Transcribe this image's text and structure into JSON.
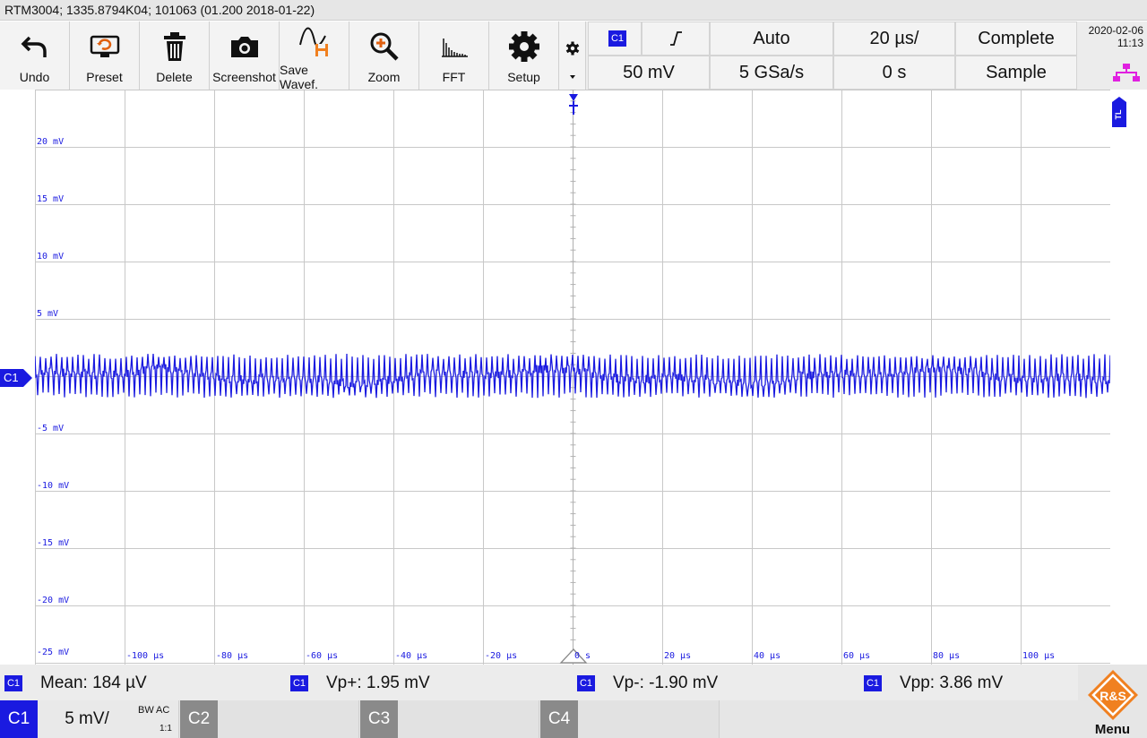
{
  "title": "RTM3004; 1335.8794K04; 101063 (01.200 2018-01-22)",
  "toolbar": [
    {
      "label": "Undo",
      "icon": "undo-icon"
    },
    {
      "label": "Preset",
      "icon": "preset-icon"
    },
    {
      "label": "Delete",
      "icon": "trash-icon"
    },
    {
      "label": "Screenshot",
      "icon": "camera-icon"
    },
    {
      "label": "Save Wavef.",
      "icon": "save-waveform-icon"
    },
    {
      "label": "Zoom",
      "icon": "zoom-icon"
    },
    {
      "label": "FFT",
      "icon": "fft-icon"
    },
    {
      "label": "Setup",
      "icon": "gear-icon"
    }
  ],
  "settings": {
    "trigger_source": "C1",
    "trigger_slope_icon": "rising-edge-icon",
    "trigger_mode": "Auto",
    "timebase": "20 µs/",
    "acquisition_state": "Complete",
    "trigger_level": "50 mV",
    "sample_rate": "5 GSa/s",
    "trigger_offset": "0 s",
    "acquisition_mode": "Sample"
  },
  "datetime": {
    "date": "2020-02-06",
    "time": "11:13"
  },
  "plot": {
    "y_labels": [
      "20 mV",
      "15 mV",
      "10 mV",
      "5 mV",
      "-5 mV",
      "-10 mV",
      "-15 mV",
      "-20 mV",
      "-25 mV"
    ],
    "x_labels": [
      "-100 µs",
      "-80 µs",
      "-60 µs",
      "-40 µs",
      "-20 µs",
      "0 s",
      "20 µs",
      "40 µs",
      "60 µs",
      "80 µs",
      "100 µs"
    ],
    "channel_marker": "C1",
    "trigger_level_marker": "TL",
    "trace_color": "#1a1ae0"
  },
  "measurements": [
    {
      "channel": "C1",
      "text": "Mean: 184 µV"
    },
    {
      "channel": "C1",
      "text": "Vp+: 1.95 mV"
    },
    {
      "channel": "C1",
      "text": "Vp-: -1.90 mV"
    },
    {
      "channel": "C1",
      "text": "Vpp: 3.86 mV"
    }
  ],
  "channels": {
    "c1": {
      "label": "C1",
      "scale": "5 mV/",
      "bw": "BW",
      "coupling": "AC",
      "probe": "1:1"
    },
    "c2": {
      "label": "C2"
    },
    "c3": {
      "label": "C3"
    },
    "c4": {
      "label": "C4"
    }
  },
  "menu": {
    "label": "Menu",
    "logo_text": "R&S"
  }
}
